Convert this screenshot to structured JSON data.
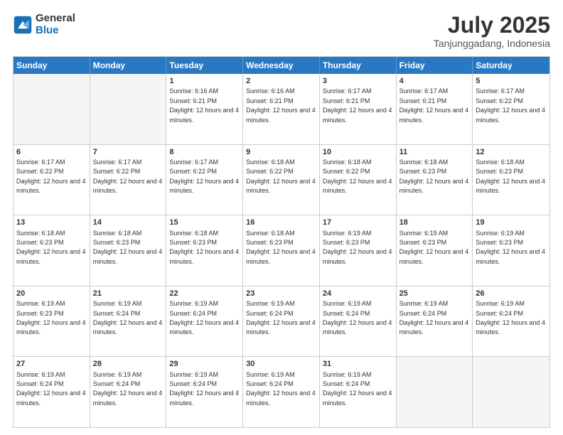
{
  "header": {
    "logo_general": "General",
    "logo_blue": "Blue",
    "month_year": "July 2025",
    "location": "Tanjunggadang, Indonesia"
  },
  "days": [
    "Sunday",
    "Monday",
    "Tuesday",
    "Wednesday",
    "Thursday",
    "Friday",
    "Saturday"
  ],
  "rows": [
    [
      {
        "day": "",
        "empty": true
      },
      {
        "day": "",
        "empty": true
      },
      {
        "day": "1",
        "sunrise": "Sunrise: 6:16 AM",
        "sunset": "Sunset: 6:21 PM",
        "daylight": "Daylight: 12 hours and 4 minutes."
      },
      {
        "day": "2",
        "sunrise": "Sunrise: 6:16 AM",
        "sunset": "Sunset: 6:21 PM",
        "daylight": "Daylight: 12 hours and 4 minutes."
      },
      {
        "day": "3",
        "sunrise": "Sunrise: 6:17 AM",
        "sunset": "Sunset: 6:21 PM",
        "daylight": "Daylight: 12 hours and 4 minutes."
      },
      {
        "day": "4",
        "sunrise": "Sunrise: 6:17 AM",
        "sunset": "Sunset: 6:21 PM",
        "daylight": "Daylight: 12 hours and 4 minutes."
      },
      {
        "day": "5",
        "sunrise": "Sunrise: 6:17 AM",
        "sunset": "Sunset: 6:22 PM",
        "daylight": "Daylight: 12 hours and 4 minutes."
      }
    ],
    [
      {
        "day": "6",
        "sunrise": "Sunrise: 6:17 AM",
        "sunset": "Sunset: 6:22 PM",
        "daylight": "Daylight: 12 hours and 4 minutes."
      },
      {
        "day": "7",
        "sunrise": "Sunrise: 6:17 AM",
        "sunset": "Sunset: 6:22 PM",
        "daylight": "Daylight: 12 hours and 4 minutes."
      },
      {
        "day": "8",
        "sunrise": "Sunrise: 6:17 AM",
        "sunset": "Sunset: 6:22 PM",
        "daylight": "Daylight: 12 hours and 4 minutes."
      },
      {
        "day": "9",
        "sunrise": "Sunrise: 6:18 AM",
        "sunset": "Sunset: 6:22 PM",
        "daylight": "Daylight: 12 hours and 4 minutes."
      },
      {
        "day": "10",
        "sunrise": "Sunrise: 6:18 AM",
        "sunset": "Sunset: 6:22 PM",
        "daylight": "Daylight: 12 hours and 4 minutes."
      },
      {
        "day": "11",
        "sunrise": "Sunrise: 6:18 AM",
        "sunset": "Sunset: 6:23 PM",
        "daylight": "Daylight: 12 hours and 4 minutes."
      },
      {
        "day": "12",
        "sunrise": "Sunrise: 6:18 AM",
        "sunset": "Sunset: 6:23 PM",
        "daylight": "Daylight: 12 hours and 4 minutes."
      }
    ],
    [
      {
        "day": "13",
        "sunrise": "Sunrise: 6:18 AM",
        "sunset": "Sunset: 6:23 PM",
        "daylight": "Daylight: 12 hours and 4 minutes."
      },
      {
        "day": "14",
        "sunrise": "Sunrise: 6:18 AM",
        "sunset": "Sunset: 6:23 PM",
        "daylight": "Daylight: 12 hours and 4 minutes."
      },
      {
        "day": "15",
        "sunrise": "Sunrise: 6:18 AM",
        "sunset": "Sunset: 6:23 PM",
        "daylight": "Daylight: 12 hours and 4 minutes."
      },
      {
        "day": "16",
        "sunrise": "Sunrise: 6:18 AM",
        "sunset": "Sunset: 6:23 PM",
        "daylight": "Daylight: 12 hours and 4 minutes."
      },
      {
        "day": "17",
        "sunrise": "Sunrise: 6:19 AM",
        "sunset": "Sunset: 6:23 PM",
        "daylight": "Daylight: 12 hours and 4 minutes."
      },
      {
        "day": "18",
        "sunrise": "Sunrise: 6:19 AM",
        "sunset": "Sunset: 6:23 PM",
        "daylight": "Daylight: 12 hours and 4 minutes."
      },
      {
        "day": "19",
        "sunrise": "Sunrise: 6:19 AM",
        "sunset": "Sunset: 6:23 PM",
        "daylight": "Daylight: 12 hours and 4 minutes."
      }
    ],
    [
      {
        "day": "20",
        "sunrise": "Sunrise: 6:19 AM",
        "sunset": "Sunset: 6:23 PM",
        "daylight": "Daylight: 12 hours and 4 minutes."
      },
      {
        "day": "21",
        "sunrise": "Sunrise: 6:19 AM",
        "sunset": "Sunset: 6:24 PM",
        "daylight": "Daylight: 12 hours and 4 minutes."
      },
      {
        "day": "22",
        "sunrise": "Sunrise: 6:19 AM",
        "sunset": "Sunset: 6:24 PM",
        "daylight": "Daylight: 12 hours and 4 minutes."
      },
      {
        "day": "23",
        "sunrise": "Sunrise: 6:19 AM",
        "sunset": "Sunset: 6:24 PM",
        "daylight": "Daylight: 12 hours and 4 minutes."
      },
      {
        "day": "24",
        "sunrise": "Sunrise: 6:19 AM",
        "sunset": "Sunset: 6:24 PM",
        "daylight": "Daylight: 12 hours and 4 minutes."
      },
      {
        "day": "25",
        "sunrise": "Sunrise: 6:19 AM",
        "sunset": "Sunset: 6:24 PM",
        "daylight": "Daylight: 12 hours and 4 minutes."
      },
      {
        "day": "26",
        "sunrise": "Sunrise: 6:19 AM",
        "sunset": "Sunset: 6:24 PM",
        "daylight": "Daylight: 12 hours and 4 minutes."
      }
    ],
    [
      {
        "day": "27",
        "sunrise": "Sunrise: 6:19 AM",
        "sunset": "Sunset: 6:24 PM",
        "daylight": "Daylight: 12 hours and 4 minutes."
      },
      {
        "day": "28",
        "sunrise": "Sunrise: 6:19 AM",
        "sunset": "Sunset: 6:24 PM",
        "daylight": "Daylight: 12 hours and 4 minutes."
      },
      {
        "day": "29",
        "sunrise": "Sunrise: 6:19 AM",
        "sunset": "Sunset: 6:24 PM",
        "daylight": "Daylight: 12 hours and 4 minutes."
      },
      {
        "day": "30",
        "sunrise": "Sunrise: 6:19 AM",
        "sunset": "Sunset: 6:24 PM",
        "daylight": "Daylight: 12 hours and 4 minutes."
      },
      {
        "day": "31",
        "sunrise": "Sunrise: 6:19 AM",
        "sunset": "Sunset: 6:24 PM",
        "daylight": "Daylight: 12 hours and 4 minutes."
      },
      {
        "day": "",
        "empty": true
      },
      {
        "day": "",
        "empty": true
      }
    ]
  ]
}
